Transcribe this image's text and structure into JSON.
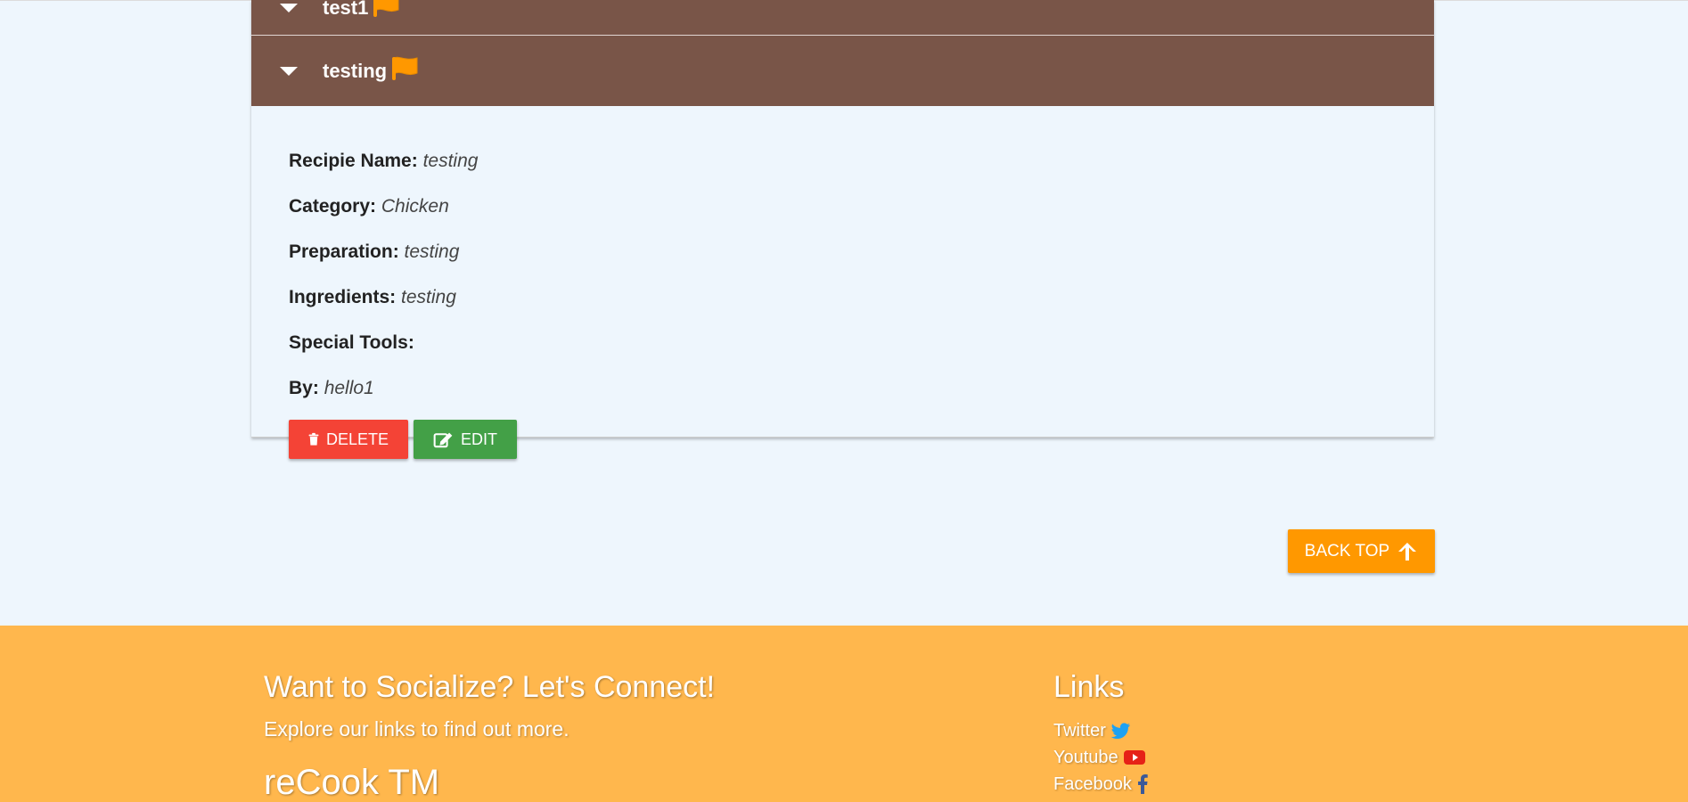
{
  "recipes": [
    {
      "title": "test1"
    },
    {
      "title": "testing"
    }
  ],
  "details": {
    "name_label": "Recipie Name:",
    "name_value": "testing",
    "category_label": "Category:",
    "category_value": "Chicken",
    "preparation_label": "Preparation:",
    "preparation_value": "testing",
    "ingredients_label": "Ingredients:",
    "ingredients_value": "testing",
    "tools_label": "Special Tools:",
    "tools_value": "",
    "by_label": "By:",
    "by_value": "hello1"
  },
  "actions": {
    "delete_label": "DELETE",
    "edit_label": "EDIT"
  },
  "back_top_label": "BACK TOP",
  "footer": {
    "heading": "Want to Socialize? Let's Connect!",
    "subtext": "Explore our links to find out more.",
    "brand": "reCook TM",
    "links_title": "Links",
    "links": [
      {
        "label": "Twitter",
        "icon": "twitter-icon"
      },
      {
        "label": "Youtube",
        "icon": "youtube-icon"
      },
      {
        "label": "Facebook",
        "icon": "facebook-icon"
      }
    ]
  },
  "colors": {
    "header": "#795548",
    "flag": "#ff9800",
    "delete": "#f44336",
    "edit": "#43a047",
    "back_top": "#ff9800",
    "footer": "#ffb74d"
  }
}
